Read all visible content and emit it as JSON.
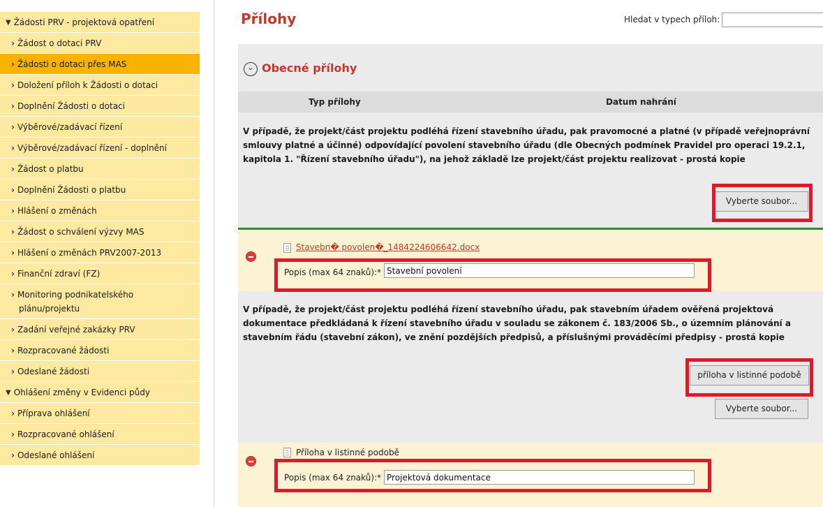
{
  "sidebar": {
    "items": [
      {
        "label": "Žádosti PRV - projektová opatření",
        "kind": "cat"
      },
      {
        "label": "Žádost o dotaci PRV",
        "kind": "sub"
      },
      {
        "label": "Žádosti o dotaci přes MAS",
        "kind": "sub",
        "active": true
      },
      {
        "label": "Doložení příloh k Žádosti o dotaci",
        "kind": "sub"
      },
      {
        "label": "Doplnění Žádosti o dotaci",
        "kind": "sub"
      },
      {
        "label": "Výběrové/zadávací řízení",
        "kind": "sub"
      },
      {
        "label": "Výběrové/zadávací řízení - doplnění",
        "kind": "sub"
      },
      {
        "label": "Žádost o platbu",
        "kind": "sub"
      },
      {
        "label": "Doplnění Žádosti o platbu",
        "kind": "sub"
      },
      {
        "label": "Hlášení o změnách",
        "kind": "sub"
      },
      {
        "label": "Žádost o schválení výzvy MAS",
        "kind": "sub"
      },
      {
        "label": "Hlášení o změnách PRV2007-2013",
        "kind": "sub"
      },
      {
        "label": "Finanční zdraví (FZ)",
        "kind": "sub"
      },
      {
        "label": "Monitoring podnikatelského",
        "label2": "plánu/projektu",
        "kind": "sub"
      },
      {
        "label": "Zadání veřejné zakázky PRV",
        "kind": "sub"
      },
      {
        "label": "Rozpracované žádosti",
        "kind": "sub"
      },
      {
        "label": "Odeslané žádosti",
        "kind": "sub"
      },
      {
        "label": "Ohlášení změny v Evidenci půdy",
        "kind": "cat"
      },
      {
        "label": "Příprava ohlášení",
        "kind": "sub"
      },
      {
        "label": "Rozpracované ohlášení",
        "kind": "sub"
      },
      {
        "label": "Odeslané ohlášení",
        "kind": "sub"
      }
    ]
  },
  "header": {
    "title": "Přílohy",
    "search_label": "Hledat v typech příloh:",
    "search_value": ""
  },
  "section": {
    "title": "Obecné přílohy",
    "col_type": "Typ přílohy",
    "col_date": "Datum nahrání"
  },
  "req1": {
    "text": "V případě, že projekt/část projektu podléhá řízení stavebního úřadu, pak pravomocné a platné (v případě veřejnoprávní smlouvy platné a účinné) odpovídající povolení stavebního úřadu (dle Obecných podmínek Pravidel pro operaci 19.2.1, kapitola 1. \"Řízení stavebního úřadu\"), na jehož základě lze projekt/část projektu realizovat - prostá kopie",
    "select_label": "Vyberte soubor...",
    "file_name": "Stavebn� povolen�_1484224606642.docx",
    "desc_label": "Popis (max 64 znaků):*",
    "desc_value": "Stavební povolení"
  },
  "req2": {
    "text": "V případě, že projekt/část projektu podléhá řízení stavebního úřadu, pak stavebním úřadem ověřená projektová dokumentace předkládaná k řízení stavebního úřadu v souladu se zákonem č. 183/2006 Sb., o územním plánování a stavebním řádu (stavební zákon), ve znění pozdějších předpisů, a příslušnými prováděcími předpisy - prostá kopie",
    "paper_label": "příloha v listinné podobě",
    "select_label": "Vyberte soubor...",
    "file_name": "Příloha v listinné podobě",
    "desc_label": "Popis (max 64 znaků):*",
    "desc_value": "Projektová dokumentace"
  },
  "colors": {
    "accent": "#c0392b",
    "sidebar_bg": "#fdeaa0",
    "sidebar_active": "#f9b200",
    "highlight_box": "#e0182b",
    "separator": "#2e8b2e"
  }
}
